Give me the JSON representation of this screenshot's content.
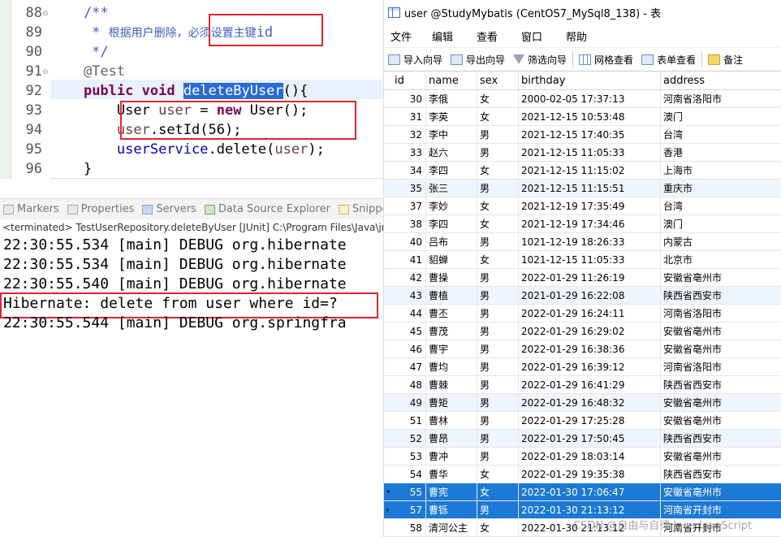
{
  "editor": {
    "lines": [
      {
        "num": "88",
        "fold": true,
        "parts": [
          {
            "t": "    /**",
            "c": "c-comment"
          }
        ]
      },
      {
        "num": "89",
        "fold": false,
        "parts": [
          {
            "t": "     * ",
            "c": "c-comment"
          },
          {
            "t": "根据用户删除，",
            "c": "c-comment-cn"
          },
          {
            "t": "必须设置主键",
            "c": "c-comment-cn"
          },
          {
            "t": "id",
            "c": "c-comment"
          }
        ]
      },
      {
        "num": "90",
        "fold": false,
        "parts": [
          {
            "t": "     */",
            "c": "c-comment"
          }
        ]
      },
      {
        "num": "91",
        "fold": true,
        "parts": [
          {
            "t": "    @Test",
            "c": "c-anno"
          }
        ]
      },
      {
        "num": "92",
        "fold": false,
        "parts": [
          {
            "t": "    ",
            "c": "c-plain"
          },
          {
            "t": "public",
            "c": "c-kw"
          },
          {
            "t": " ",
            "c": "c-plain"
          },
          {
            "t": "void",
            "c": "c-kw"
          },
          {
            "t": " ",
            "c": "c-plain"
          },
          {
            "t": "deleteByUser",
            "c": "c-sel"
          },
          {
            "t": "(){",
            "c": "c-plain"
          }
        ]
      },
      {
        "num": "93",
        "fold": false,
        "parts": [
          {
            "t": "        User ",
            "c": "c-plain"
          },
          {
            "t": "user",
            "c": "c-var"
          },
          {
            "t": " = ",
            "c": "c-plain"
          },
          {
            "t": "new",
            "c": "c-kw"
          },
          {
            "t": " User();",
            "c": "c-plain"
          }
        ]
      },
      {
        "num": "94",
        "fold": false,
        "parts": [
          {
            "t": "        ",
            "c": "c-plain"
          },
          {
            "t": "user",
            "c": "c-var"
          },
          {
            "t": ".setId(56);",
            "c": "c-plain"
          }
        ]
      },
      {
        "num": "95",
        "fold": false,
        "parts": [
          {
            "t": "        ",
            "c": "c-plain"
          },
          {
            "t": "userService",
            "c": "c-field"
          },
          {
            "t": ".delete(",
            "c": "c-plain"
          },
          {
            "t": "user",
            "c": "c-var"
          },
          {
            "t": ");",
            "c": "c-plain"
          }
        ]
      },
      {
        "num": "96",
        "fold": false,
        "parts": [
          {
            "t": "    }",
            "c": "c-plain"
          }
        ]
      }
    ]
  },
  "views": {
    "tabs": [
      {
        "label": "Markers",
        "icon": "markers-icon"
      },
      {
        "label": "Properties",
        "icon": "properties-icon"
      },
      {
        "label": "Servers",
        "icon": "servers-icon"
      },
      {
        "label": "Data Source Explorer",
        "icon": "data-source-icon"
      },
      {
        "label": "Snippets",
        "icon": "snippets-icon"
      }
    ],
    "status": "<terminated> TestUserRepository.deleteByUser [JUnit] C:\\Program Files\\Java\\jre"
  },
  "console": {
    "lines": [
      "22:30:55.534 [main] DEBUG org.hibernate",
      "22:30:55.534 [main] DEBUG org.hibernate",
      "22:30:55.540 [main] DEBUG org.hibernate",
      "Hibernate: delete from user where id=?",
      "22:30:55.544 [main] DEBUG org.springfra"
    ]
  },
  "window": {
    "title": "user @StudyMybatis (CentOS7_MySql8_138) - 表"
  },
  "menu": [
    "文件",
    "编辑",
    "查看",
    "窗口",
    "帮助"
  ],
  "toolbar": [
    {
      "label": "导入向导",
      "icon": "import-icon"
    },
    {
      "label": "导出向导",
      "icon": "export-icon"
    },
    {
      "label": "筛选向导",
      "icon": "filter-icon"
    },
    {
      "label": "网格查看",
      "icon": "grid-view-icon"
    },
    {
      "label": "表单查看",
      "icon": "form-view-icon"
    },
    {
      "label": "备注",
      "icon": "note-icon"
    }
  ],
  "table": {
    "columns": [
      "id",
      "name",
      "sex",
      "birthday",
      "address"
    ],
    "rows": [
      {
        "id": "30",
        "name": "李俄",
        "sex": "女",
        "birthday": "2000-02-05 17:37:13",
        "address": "河南省洛阳市"
      },
      {
        "id": "31",
        "name": "李英",
        "sex": "女",
        "birthday": "2021-12-15 10:53:48",
        "address": "澳门"
      },
      {
        "id": "32",
        "name": "李中",
        "sex": "男",
        "birthday": "2021-12-15 17:40:35",
        "address": "台湾"
      },
      {
        "id": "33",
        "name": "赵六",
        "sex": "男",
        "birthday": "2021-12-15 11:05:33",
        "address": "香港"
      },
      {
        "id": "34",
        "name": "李四",
        "sex": "女",
        "birthday": "2021-12-15 11:15:02",
        "address": "上海市"
      },
      {
        "id": "35",
        "name": "张三",
        "sex": "男",
        "birthday": "2021-12-15 11:15:51",
        "address": "重庆市"
      },
      {
        "id": "37",
        "name": "李妙",
        "sex": "女",
        "birthday": "2021-12-19 17:35:49",
        "address": "台湾"
      },
      {
        "id": "38",
        "name": "李四",
        "sex": "女",
        "birthday": "2021-12-19 17:34:46",
        "address": "澳门"
      },
      {
        "id": "40",
        "name": "吕布",
        "sex": "男",
        "birthday": "1021-12-19 18:26:33",
        "address": "内蒙古"
      },
      {
        "id": "41",
        "name": "貂蝉",
        "sex": "女",
        "birthday": "1021-12-15 11:05:33",
        "address": "北京市"
      },
      {
        "id": "42",
        "name": "曹操",
        "sex": "男",
        "birthday": "2022-01-29 11:26:19",
        "address": "安徽省亳州市"
      },
      {
        "id": "43",
        "name": "曹植",
        "sex": "男",
        "birthday": "2021-01-29 16:22:08",
        "address": "陕西省西安市"
      },
      {
        "id": "44",
        "name": "曹丕",
        "sex": "男",
        "birthday": "2022-01-29 16:24:11",
        "address": "河南省洛阳市"
      },
      {
        "id": "45",
        "name": "曹茂",
        "sex": "男",
        "birthday": "2022-01-29 16:29:02",
        "address": "安徽省亳州市"
      },
      {
        "id": "46",
        "name": "曹宇",
        "sex": "男",
        "birthday": "2022-01-29 16:38:36",
        "address": "安徽省亳州市"
      },
      {
        "id": "47",
        "name": "曹均",
        "sex": "男",
        "birthday": "2022-01-29 16:39:12",
        "address": "河南省洛阳市"
      },
      {
        "id": "48",
        "name": "曹棘",
        "sex": "男",
        "birthday": "2022-01-29 16:41:29",
        "address": "陕西省西安市"
      },
      {
        "id": "49",
        "name": "曹矩",
        "sex": "男",
        "birthday": "2022-01-29 16:48:32",
        "address": "安徽省亳州市"
      },
      {
        "id": "51",
        "name": "曹林",
        "sex": "男",
        "birthday": "2022-01-29 17:25:28",
        "address": "安徽省亳州市"
      },
      {
        "id": "52",
        "name": "曹昂",
        "sex": "男",
        "birthday": "2022-01-29 17:50:45",
        "address": "陕西省西安市"
      },
      {
        "id": "53",
        "name": "曹冲",
        "sex": "男",
        "birthday": "2022-01-29 18:03:14",
        "address": "安徽省亳州市"
      },
      {
        "id": "54",
        "name": "曹华",
        "sex": "女",
        "birthday": "2022-01-29 19:35:38",
        "address": "陕西省西安市"
      },
      {
        "id": "55",
        "name": "曹宪",
        "sex": "女",
        "birthday": "2022-01-30 17:06:47",
        "address": "安徽省亳州市",
        "marker": "•"
      },
      {
        "id": "57",
        "name": "曹铄",
        "sex": "男",
        "birthday": "2022-01-30 21:13:12",
        "address": "河南省开封市",
        "marker": "›"
      },
      {
        "id": "58",
        "name": "清河公主",
        "sex": "女",
        "birthday": "2022-01-30 21:13:12",
        "address": "河南省开封市"
      }
    ]
  },
  "watermark": "CSDN @自由与自律 Java JavaScript"
}
